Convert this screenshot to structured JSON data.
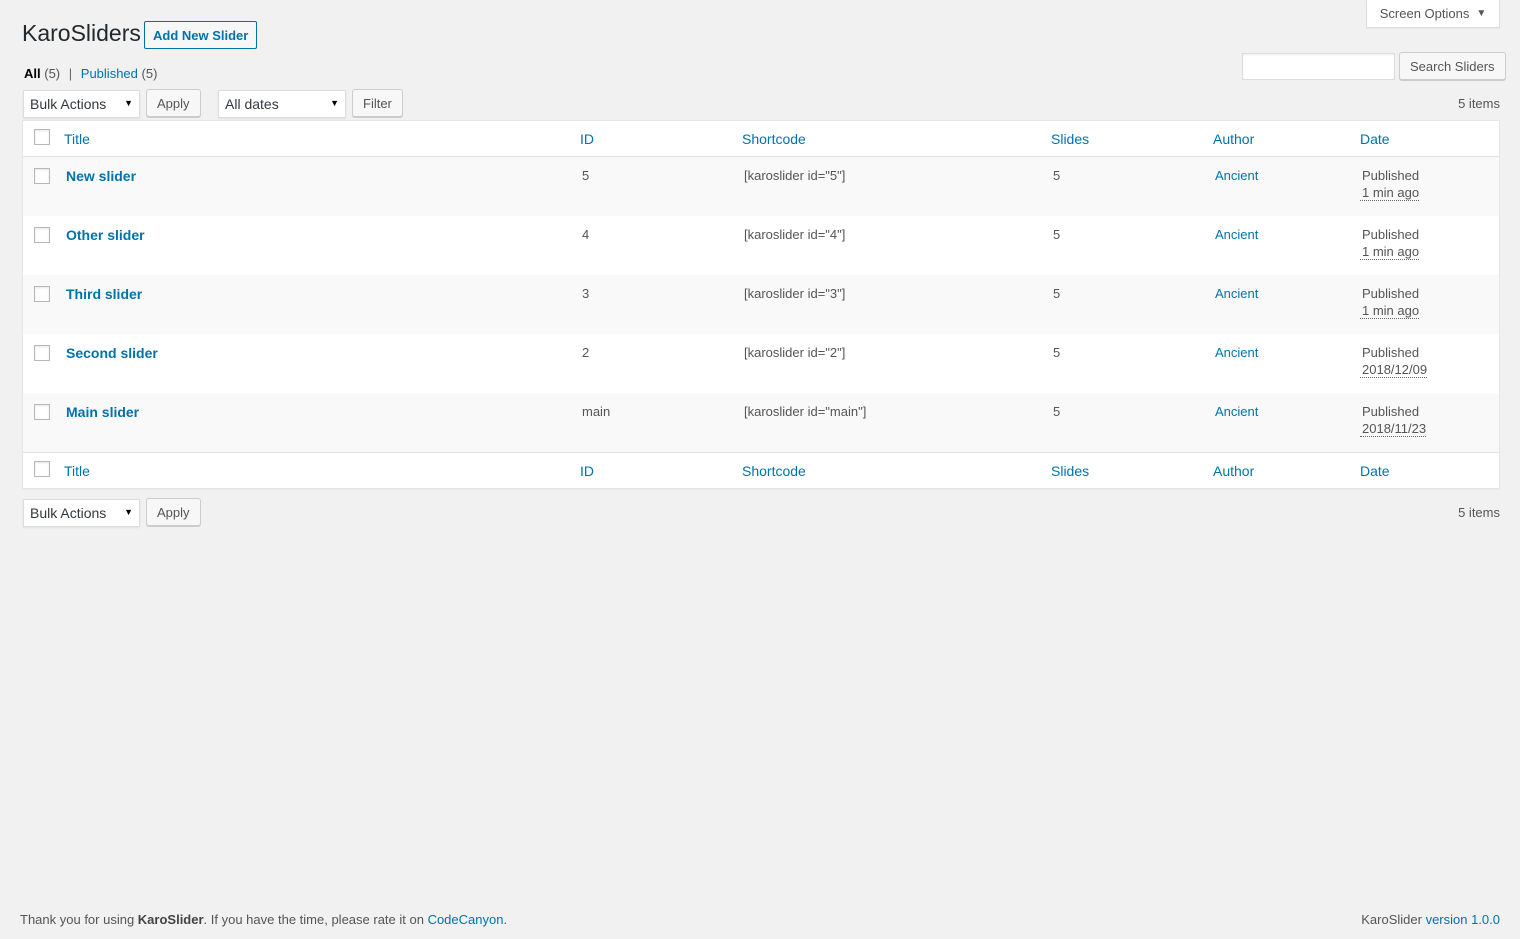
{
  "screen_options": {
    "label": "Screen Options"
  },
  "header": {
    "title": "KaroSliders",
    "add_new_label": "Add New Slider"
  },
  "views": {
    "all_label": "All",
    "all_count": "(5)",
    "separator": "|",
    "published_label": "Published",
    "published_count": "(5)"
  },
  "search": {
    "button_label": "Search Sliders",
    "value": ""
  },
  "top_nav": {
    "bulk_actions": "Bulk Actions",
    "apply": "Apply",
    "dates": "All dates",
    "filter": "Filter",
    "items_count": "5 items"
  },
  "bottom_nav": {
    "bulk_actions": "Bulk Actions",
    "apply": "Apply",
    "items_count": "5 items"
  },
  "table": {
    "columns": [
      "Title",
      "ID",
      "Shortcode",
      "Slides",
      "Author",
      "Date"
    ],
    "rows": [
      {
        "title": "New slider",
        "id": "5",
        "shortcode": "[karoslider id=\"5\"]",
        "slides": "5",
        "author": "Ancient",
        "status": "Published",
        "date": "1 min ago"
      },
      {
        "title": "Other slider",
        "id": "4",
        "shortcode": "[karoslider id=\"4\"]",
        "slides": "5",
        "author": "Ancient",
        "status": "Published",
        "date": "1 min ago"
      },
      {
        "title": "Third slider",
        "id": "3",
        "shortcode": "[karoslider id=\"3\"]",
        "slides": "5",
        "author": "Ancient",
        "status": "Published",
        "date": "1 min ago"
      },
      {
        "title": "Second slider",
        "id": "2",
        "shortcode": "[karoslider id=\"2\"]",
        "slides": "5",
        "author": "Ancient",
        "status": "Published",
        "date": "2018/12/09"
      },
      {
        "title": "Main slider",
        "id": "main",
        "shortcode": "[karoslider id=\"main\"]",
        "slides": "5",
        "author": "Ancient",
        "status": "Published",
        "date": "2018/11/23"
      }
    ]
  },
  "footer": {
    "thanks_prefix": "Thank you for using ",
    "product": "KaroSlider",
    "thanks_middle": ". If you have the time, please rate it on ",
    "rate_link": "CodeCanyon",
    "thanks_suffix": ".",
    "version_product": "KaroSlider ",
    "version_link": "version 1.0.0"
  }
}
